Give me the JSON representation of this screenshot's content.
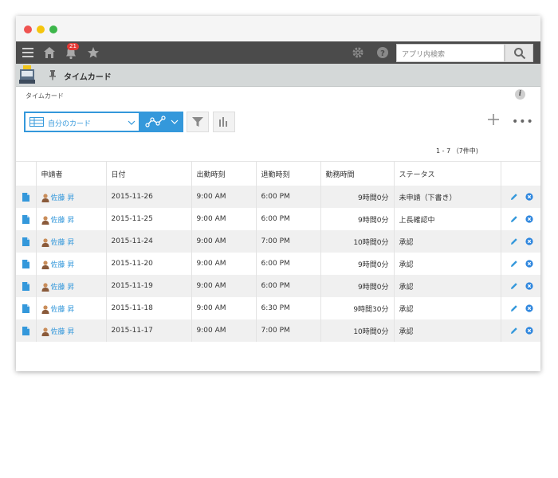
{
  "topbar": {
    "notification_count": "21",
    "search_placeholder": "アプリ内検索"
  },
  "app": {
    "title": "タイムカード"
  },
  "breadcrumb": "タイムカード",
  "info_label": "i",
  "toolbar": {
    "view_label": "自分のカード"
  },
  "pagination": "1 - 7 （7件中)",
  "table": {
    "headers": [
      "申請者",
      "日付",
      "出勤時刻",
      "退勤時刻",
      "勤務時間",
      "ステータス"
    ],
    "rows": [
      {
        "user": "佐藤 昇",
        "date": "2015-11-26",
        "in": "9:00 AM",
        "out": "6:00 PM",
        "hours": "9時間0分",
        "status": "未申請（下書き）"
      },
      {
        "user": "佐藤 昇",
        "date": "2015-11-25",
        "in": "9:00 AM",
        "out": "6:00 PM",
        "hours": "9時間0分",
        "status": "上長確認中"
      },
      {
        "user": "佐藤 昇",
        "date": "2015-11-24",
        "in": "9:00 AM",
        "out": "7:00 PM",
        "hours": "10時間0分",
        "status": "承認"
      },
      {
        "user": "佐藤 昇",
        "date": "2015-11-20",
        "in": "9:00 AM",
        "out": "6:00 PM",
        "hours": "9時間0分",
        "status": "承認"
      },
      {
        "user": "佐藤 昇",
        "date": "2015-11-19",
        "in": "9:00 AM",
        "out": "6:00 PM",
        "hours": "9時間0分",
        "status": "承認"
      },
      {
        "user": "佐藤 昇",
        "date": "2015-11-18",
        "in": "9:00 AM",
        "out": "6:30 PM",
        "hours": "9時間30分",
        "status": "承認"
      },
      {
        "user": "佐藤 昇",
        "date": "2015-11-17",
        "in": "9:00 AM",
        "out": "7:00 PM",
        "hours": "10時間0分",
        "status": "承認"
      }
    ]
  },
  "colors": {
    "accent": "#3498db",
    "topbar": "#4b4b4b",
    "appbar": "#d4d8d8",
    "delete": "#2e86de"
  }
}
